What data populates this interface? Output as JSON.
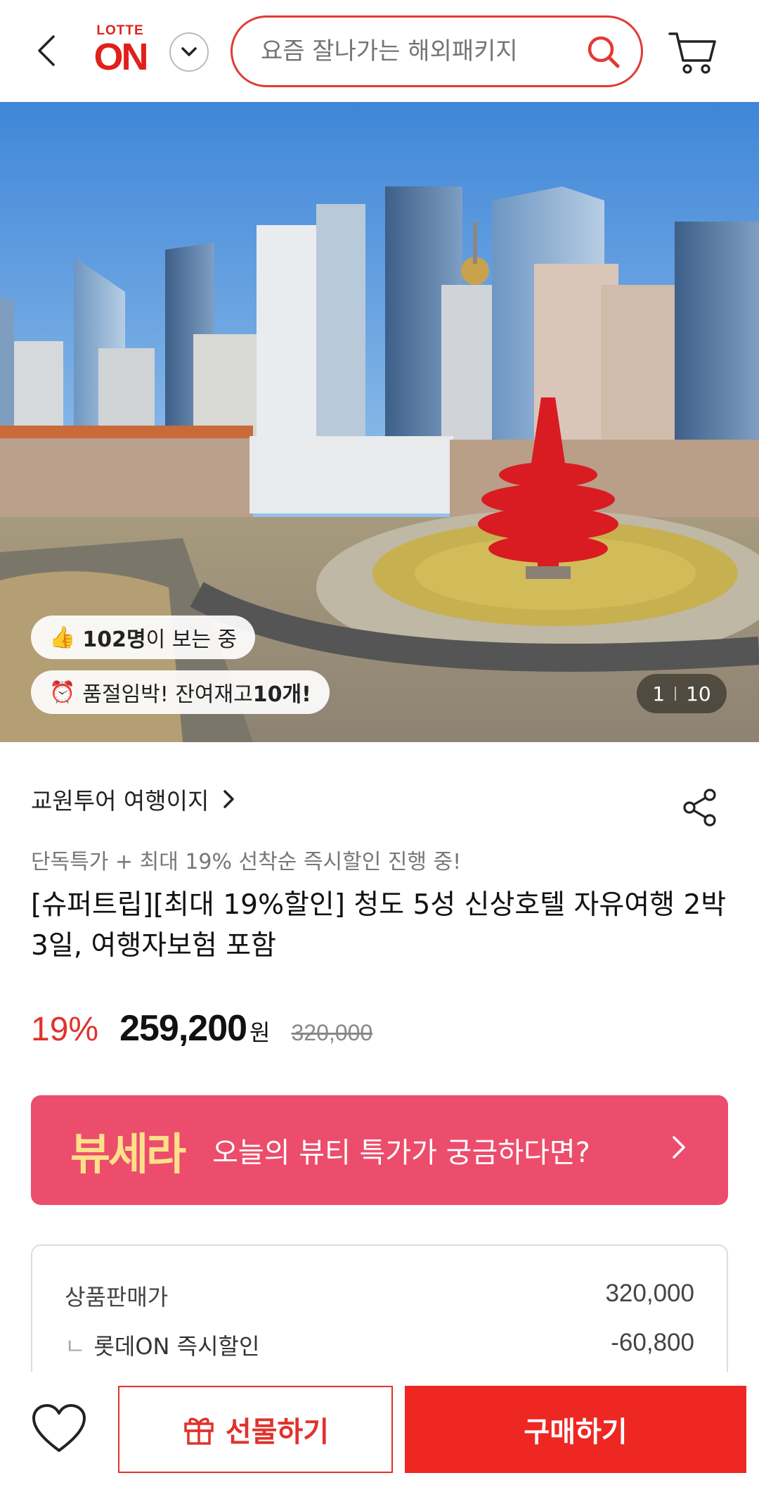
{
  "header": {
    "logo_top": "LOTTE",
    "logo_main": "ON",
    "search_placeholder": "요즘 잘나가는 해외패키지"
  },
  "hero": {
    "viewers_count": "102명",
    "viewers_suffix": "이 보는 중",
    "stock_prefix": "품절임박! 잔여재고 ",
    "stock_count": "10개!",
    "image_index": "1",
    "image_total": "10"
  },
  "product": {
    "seller": "교원투어 여행이지",
    "promo": "단독특가 + 최대 19% 선착순 즉시할인 진행 중!",
    "title": "[슈퍼트립][최대 19%할인] 청도 5성 신상호텔 자유여행 2박 3일, 여행자보험 포함",
    "discount": "19%",
    "price": "259,200",
    "currency": "원",
    "original_price": "320,000"
  },
  "banner": {
    "brand": "뷰세라",
    "text": "오늘의 뷰티 특가가 궁금하다면?"
  },
  "breakdown": {
    "rows": [
      {
        "label": "상품판매가",
        "value": "320,000"
      },
      {
        "label": "롯데ON 즉시할인",
        "value": "-60,800",
        "prefix": "ㄴ"
      }
    ]
  },
  "bottom": {
    "gift_label": "선물하기",
    "buy_label": "구매하기"
  },
  "colors": {
    "accent": "#e0322c",
    "buy": "#ee2722",
    "banner": "#ec4d6c",
    "banner_brand": "#ffe08a"
  }
}
